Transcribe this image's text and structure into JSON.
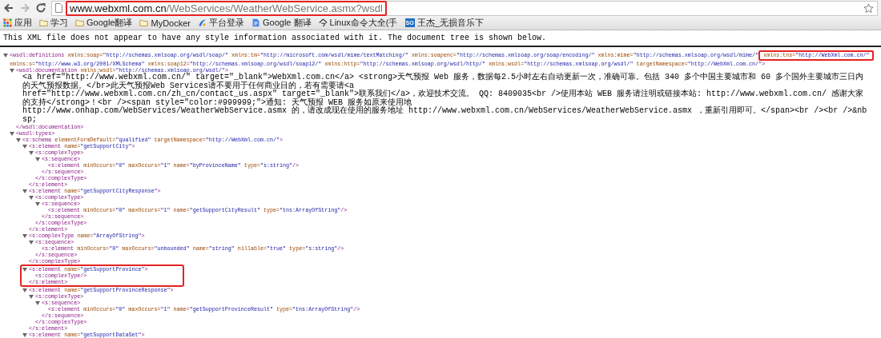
{
  "toolbar": {
    "back_enabled": true,
    "forward_enabled": false,
    "url_host": "www.webxml.com.cn",
    "url_path": "/WebServices/WeatherWebService.asmx?wsdl",
    "url_boxed": true
  },
  "bookmarks": [
    {
      "label": "应用",
      "kind": "apps"
    },
    {
      "label": "学习",
      "kind": "folder"
    },
    {
      "label": "Google翻译",
      "kind": "folder"
    },
    {
      "label": "MyDocker",
      "kind": "folder"
    },
    {
      "label": "平台登录",
      "kind": "site"
    },
    {
      "label": "Google 翻译",
      "kind": "doc"
    },
    {
      "label": "Linux命令大全(手",
      "kind": "command"
    },
    {
      "label": "王杰_无损音乐下",
      "kind": "badge",
      "icon_text": "SO"
    }
  ],
  "notice": "This XML file does not appear to have any style information associated with it. The document tree is shown below.",
  "tree": {
    "kind": "element",
    "expanded": true,
    "open": [
      {
        "text": "<wsdl:definitions xmlns:soap=\"http://schemas.xmlsoap.org/wsdl/soap/\" xmlns:tm=\"http://microsoft.com/wsdl/mime/textMatching/\" xmlns:soapenc=\"http://schemas.xmlsoap.org/soap/encoding/\" xmlns:mime=\"http://schemas.xmlsoap.org/wsdl/mime/\"",
        "boxed_tail": " xmlns:tns=\"http://WebXml.com.cn/\""
      },
      {
        "text": "xmlns:s=\"http://www.w3.org/2001/XMLSchema\" xmlns:soap12=\"http://schemas.xmlsoap.org/wsdl/soap12/\" xmlns:http=\"http://schemas.xmlsoap.org/wsdl/http/\" xmlns:wsdl=\"http://schemas.xmlsoap.org/wsdl/\" targetNamespace=\"http://WebXml.com.cn/\">"
      }
    ],
    "children": [
      {
        "kind": "element",
        "expanded": true,
        "open": [
          {
            "text": "<wsdl:documentation xmlns:wsdl=\"http://schemas.xmlsoap.org/wsdl/\">"
          }
        ],
        "children": [
          {
            "kind": "text",
            "text": "<a href=\"http://www.webxml.com.cn/\" target=\"_blank\">WebXml.com.cn</a> <strong>天气预报 Web 服务，数据每2.5小时左右自动更新一次，准确可靠。包括 340 多个中国主要城市和 60 多个国外主要城市三日内的天气预报数据。</br>此天气预报Web Services请不要用于任何商业目的，若有需要请<a"
          },
          {
            "kind": "text",
            "text": "href=\"http://www.webxml.com.cn/zh_cn/contact_us.aspx\" target=\"_blank\">联系我们</a>，欢迎技术交流。 QQ: 8409035<br />使用本站 WEB 服务请注明或链接本站: http://www.webxml.com.cn/ 感谢大家的支持</strong>！<br /><span style=\"color:#999999;\">通知: 天气预报 WEB 服务如原来使用地"
          },
          {
            "kind": "text",
            "text": "http://www.onhap.com/WebServices/WeatherWebService.asmx 的，请改成现在使用的服务地址 http://www.webxml.com.cn/WebServices/WeatherWebService.asmx ，重新引用即可。</span><br /><br />&nbsp;"
          }
        ],
        "close": "</wsdl:documentation>"
      },
      {
        "kind": "element",
        "expanded": true,
        "open": [
          {
            "text": "<wsdl:types>"
          }
        ],
        "children": [
          {
            "kind": "element",
            "expanded": true,
            "open": [
              {
                "text": "<s:schema elementFormDefault=\"qualified\" targetNamespace=\"http://WebXml.com.cn/\">"
              }
            ],
            "children": [
              {
                "kind": "element",
                "expanded": true,
                "open": [
                  {
                    "text": "<s:element name=\"getSupportCity\">"
                  }
                ],
                "children": [
                  {
                    "kind": "element",
                    "expanded": true,
                    "open": [
                      {
                        "text": "<s:complexType>"
                      }
                    ],
                    "children": [
                      {
                        "kind": "element",
                        "expanded": true,
                        "open": [
                          {
                            "text": "<s:sequence>"
                          }
                        ],
                        "children": [
                          {
                            "kind": "leaf",
                            "text": "<s:element minOccurs=\"0\" maxOccurs=\"1\" name=\"byProvinceName\" type=\"s:string\"/>"
                          }
                        ],
                        "close": "</s:sequence>"
                      }
                    ],
                    "close": "</s:complexType>"
                  }
                ],
                "close": "</s:element>"
              },
              {
                "kind": "element",
                "expanded": true,
                "open": [
                  {
                    "text": "<s:element name=\"getSupportCityResponse\">"
                  }
                ],
                "children": [
                  {
                    "kind": "element",
                    "expanded": true,
                    "open": [
                      {
                        "text": "<s:complexType>"
                      }
                    ],
                    "children": [
                      {
                        "kind": "element",
                        "expanded": true,
                        "open": [
                          {
                            "text": "<s:sequence>"
                          }
                        ],
                        "children": [
                          {
                            "kind": "leaf",
                            "text": "<s:element minOccurs=\"0\" maxOccurs=\"1\" name=\"getSupportCityResult\" type=\"tns:ArrayOfString\"/>"
                          }
                        ],
                        "close": "</s:sequence>"
                      }
                    ],
                    "close": "</s:complexType>"
                  }
                ],
                "close": "</s:element>"
              },
              {
                "kind": "element",
                "expanded": true,
                "open": [
                  {
                    "text": "<s:complexType name=\"ArrayOfString\">"
                  }
                ],
                "children": [
                  {
                    "kind": "element",
                    "expanded": true,
                    "open": [
                      {
                        "text": "<s:sequence>"
                      }
                    ],
                    "children": [
                      {
                        "kind": "leaf",
                        "text": "<s:element minOccurs=\"0\" maxOccurs=\"unbounded\" name=\"string\" nillable=\"true\" type=\"s:string\"/>"
                      }
                    ],
                    "close": "</s:sequence>"
                  }
                ],
                "close": "</s:complexType>"
              },
              {
                "kind": "element",
                "expanded": true,
                "boxed": true,
                "open": [
                  {
                    "text": "<s:element name=\"getSupportProvince\">"
                  }
                ],
                "children": [
                  {
                    "kind": "leaf",
                    "text": "<s:complexType/>"
                  }
                ],
                "close": "</s:element>"
              },
              {
                "kind": "element",
                "expanded": true,
                "open": [
                  {
                    "text": "<s:element name=\"getSupportProvinceResponse\">"
                  }
                ],
                "children": [
                  {
                    "kind": "element",
                    "expanded": true,
                    "open": [
                      {
                        "text": "<s:complexType>"
                      }
                    ],
                    "children": [
                      {
                        "kind": "element",
                        "expanded": true,
                        "open": [
                          {
                            "text": "<s:sequence>"
                          }
                        ],
                        "children": [
                          {
                            "kind": "leaf",
                            "text": "<s:element minOccurs=\"0\" maxOccurs=\"1\" name=\"getSupportProvinceResult\" type=\"tns:ArrayOfString\"/>"
                          }
                        ],
                        "close": "</s:sequence>"
                      }
                    ],
                    "close": "</s:complexType>"
                  }
                ],
                "close": "</s:element>"
              },
              {
                "kind": "element",
                "expanded": true,
                "open": [
                  {
                    "text": "<s:element name=\"getSupportDataSet\">"
                  }
                ]
              }
            ]
          }
        ]
      }
    ]
  }
}
